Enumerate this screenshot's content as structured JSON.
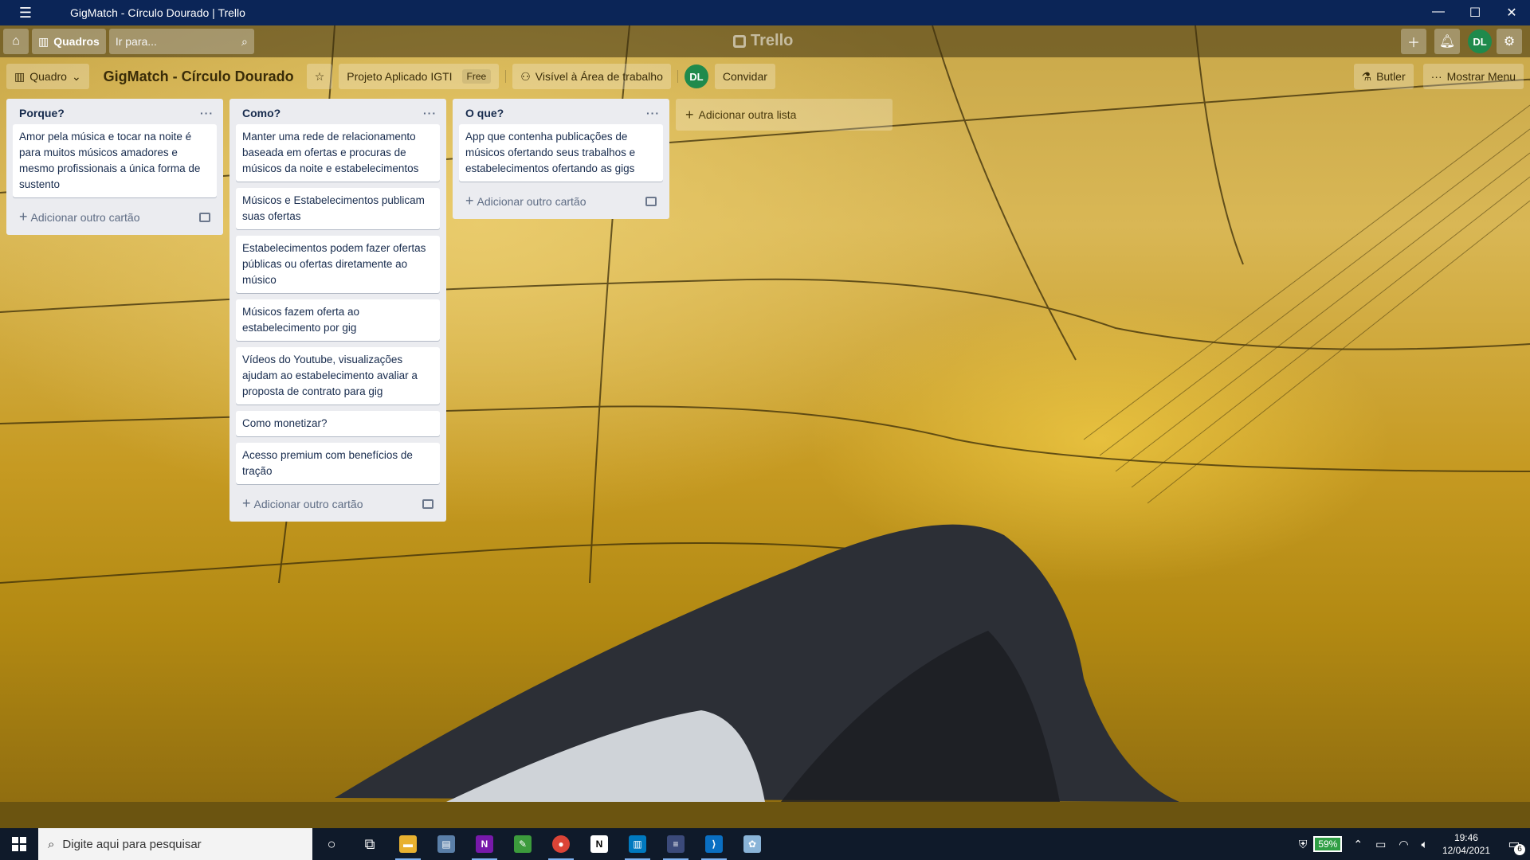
{
  "window": {
    "title": "GigMatch - Círculo Dourado | Trello"
  },
  "header": {
    "boards_label": "Quadros",
    "search_placeholder": "Ir para...",
    "logo_text": "Trello",
    "avatar_initials": "DL"
  },
  "board": {
    "view_label": "Quadro",
    "title": "GigMatch - Círculo Dourado",
    "workspace_label": "Projeto Aplicado IGTI",
    "workspace_badge": "Free",
    "visibility_label": "Visível à Área de trabalho",
    "member_initials": "DL",
    "invite_label": "Convidar",
    "butler_label": "Butler",
    "menu_label": "Mostrar Menu"
  },
  "lists": [
    {
      "title": "Porque?",
      "cards": [
        "Amor pela música e tocar na noite é para muitos músicos amadores e mesmo profissionais a única forma de sustento"
      ],
      "add_card_label": "Adicionar outro cartão"
    },
    {
      "title": "Como?",
      "cards": [
        "Manter uma rede de relacionamento baseada em ofertas e procuras de músicos da noite e estabelecimentos",
        "Músicos e Estabelecimentos publicam suas ofertas",
        "Estabelecimentos podem fazer ofertas públicas ou ofertas diretamente ao músico",
        "Músicos fazem oferta ao estabelecimento por gig",
        "Vídeos do Youtube, visualizações ajudam ao estabelecimento avaliar a proposta de contrato para gig",
        "Como monetizar?",
        "Acesso premium com benefícios de tração"
      ],
      "add_card_label": "Adicionar outro cartão"
    },
    {
      "title": "O que?",
      "cards": [
        "App que contenha publicações de músicos ofertando seus trabalhos e estabelecimentos ofertando as gigs"
      ],
      "add_card_label": "Adicionar outro cartão"
    }
  ],
  "add_list_label": "Adicionar outra lista",
  "taskbar": {
    "search_placeholder": "Digite aqui para pesquisar",
    "battery": "59%",
    "time": "19:46",
    "date": "12/04/2021",
    "notifications": "6"
  },
  "icons": {
    "menu": "menu-icon",
    "home": "home-icon",
    "boards": "boards-icon",
    "search": "search-icon",
    "add": "plus-icon",
    "bell": "bell-icon",
    "settings": "gear-icon",
    "star": "star-icon",
    "butler": "butler-icon"
  },
  "colors": {
    "titlebar": "#0b2557",
    "avatar": "#1f8a4c",
    "list_bg": "#ebecf0"
  }
}
